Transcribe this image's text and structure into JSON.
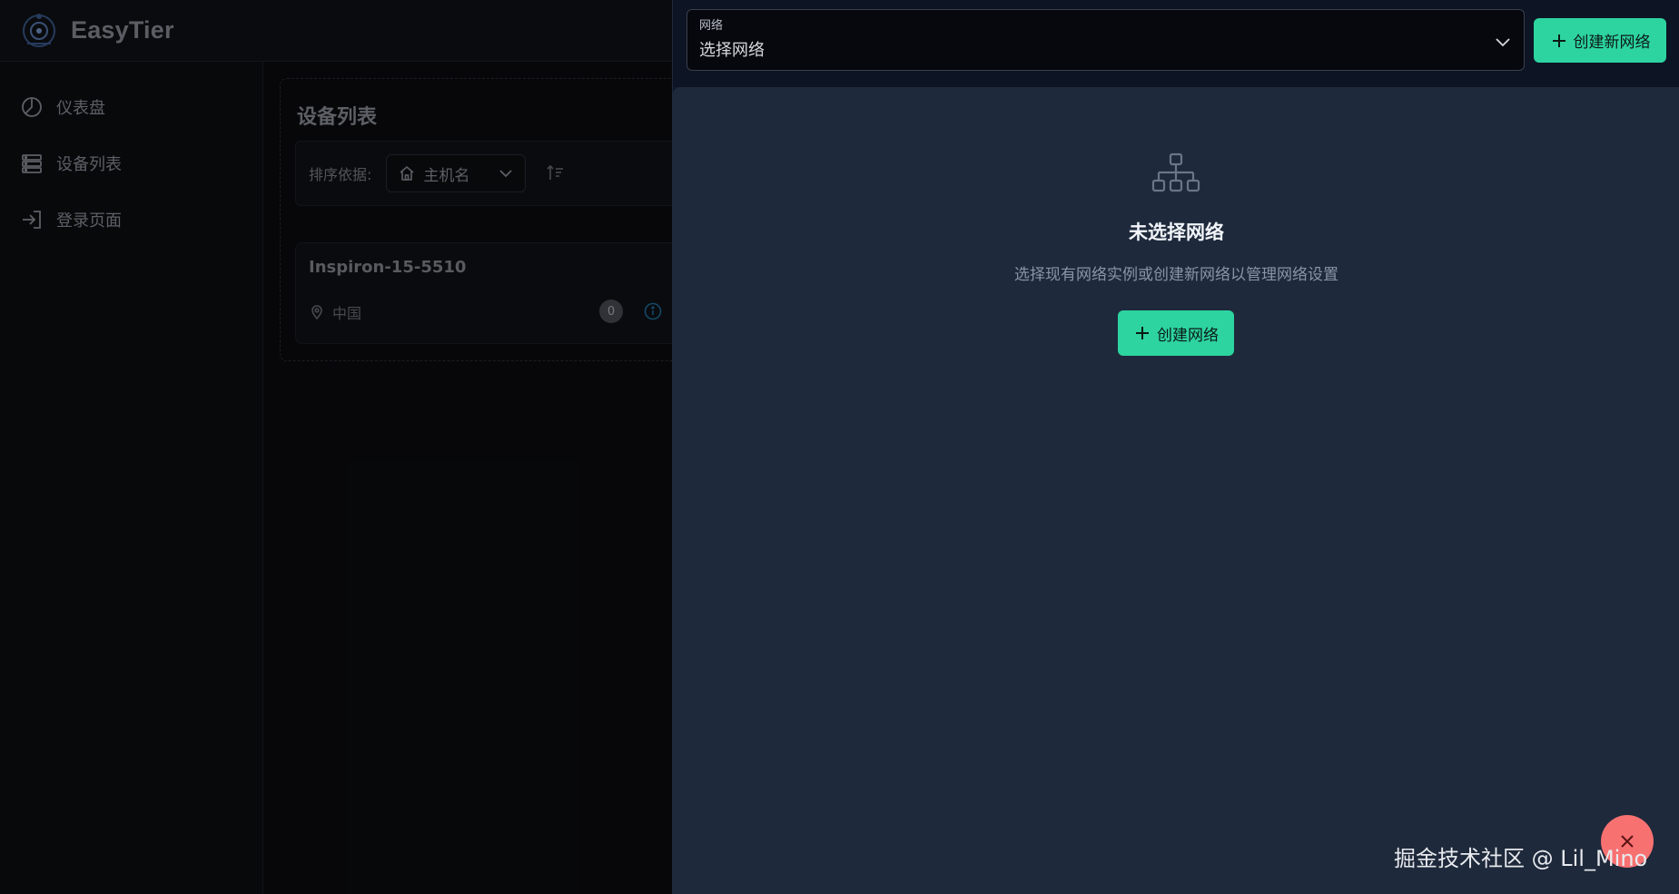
{
  "app": {
    "brand": "EasyTier"
  },
  "sidebar": {
    "items": [
      {
        "label": "仪表盘",
        "icon": "chart-pie-icon"
      },
      {
        "label": "设备列表",
        "icon": "server-icon"
      },
      {
        "label": "登录页面",
        "icon": "sign-in-icon"
      }
    ]
  },
  "devices": {
    "title": "设备列表",
    "sort_label": "排序依据:",
    "sort_value": "主机名",
    "card": {
      "hostname": "Inspiron-15-5510",
      "location": "中国",
      "count": "0"
    }
  },
  "drawer": {
    "select_label": "网络",
    "select_placeholder": "选择网络",
    "create_new_label": "创建新网络",
    "empty_title": "未选择网络",
    "empty_desc": "选择现有网络实例或创建新网络以管理网络设置",
    "create_label": "创建网络"
  },
  "watermark": "掘金技术社区 @ Lil_Mino",
  "colors": {
    "accent": "#2dd4a0",
    "drawer_bg": "#1e293b",
    "close_fab": "#f87171"
  }
}
